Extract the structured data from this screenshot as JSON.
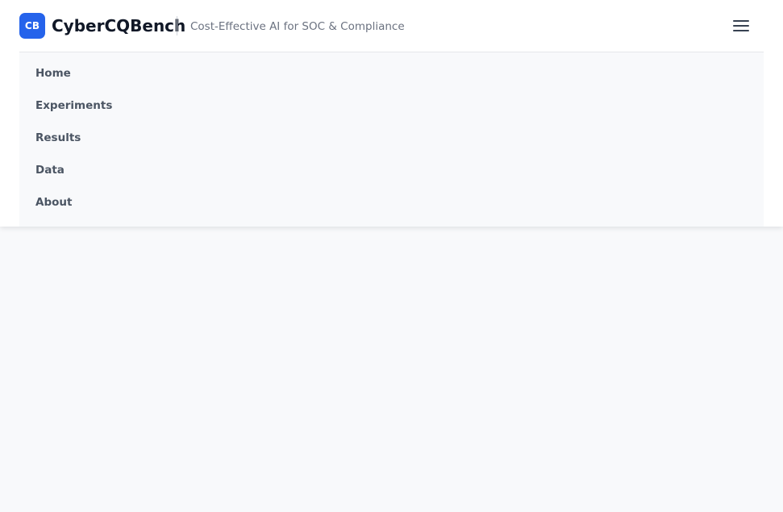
{
  "brand": {
    "badge_text": "CB",
    "name": "CyberCQBench",
    "tagline": "Cost-Effective AI for SOC & Compliance",
    "accent_color": "#2563eb"
  },
  "header": {
    "menu_icon": "hamburger-menu-icon"
  },
  "nav": {
    "items": [
      {
        "label": "Home"
      },
      {
        "label": "Experiments"
      },
      {
        "label": "Results"
      },
      {
        "label": "Data"
      },
      {
        "label": "About"
      }
    ]
  }
}
